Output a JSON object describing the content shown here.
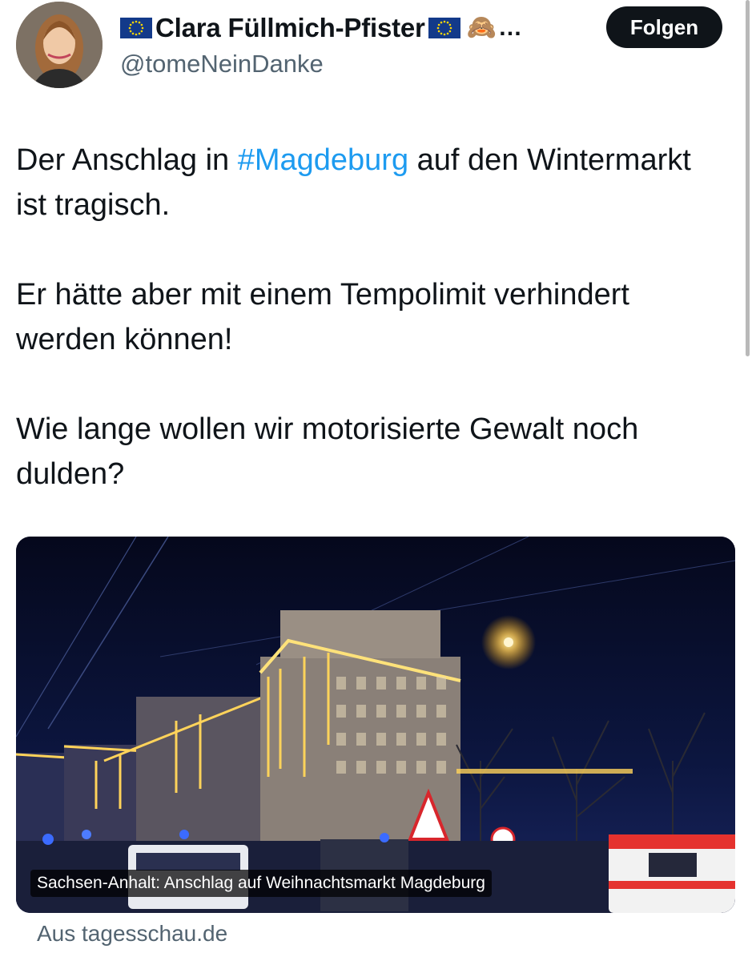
{
  "author": {
    "display_name": "Clara Füllmich-Pfister",
    "handle": "@tomeNeinDanke",
    "badges": [
      "eu-flag-icon",
      "eu-flag-icon",
      "see-no-evil-monkey-icon"
    ],
    "truncation": "…"
  },
  "follow_label": "Folgen",
  "tweet": {
    "line1_pre": "Der Anschlag in ",
    "hashtag": "#Magdeburg",
    "line1_post": " auf den Wintermarkt ist tragisch.",
    "paragraph2": "Er hätte aber mit einem Tempolimit verhindert werden können!",
    "paragraph3": "Wie lange wollen wir motorisierte Gewalt noch dulden?"
  },
  "link_card": {
    "caption": "Sachsen-Anhalt: Anschlag auf Weihnachtsmarkt Magdeburg",
    "source": "Aus tagesschau.de"
  },
  "colors": {
    "hashtag": "#1d9bf0",
    "follow_button_bg": "#0f1419",
    "secondary_text": "#536471",
    "eu_flag_blue": "#133a8a",
    "eu_flag_stars": "#ffd700"
  }
}
